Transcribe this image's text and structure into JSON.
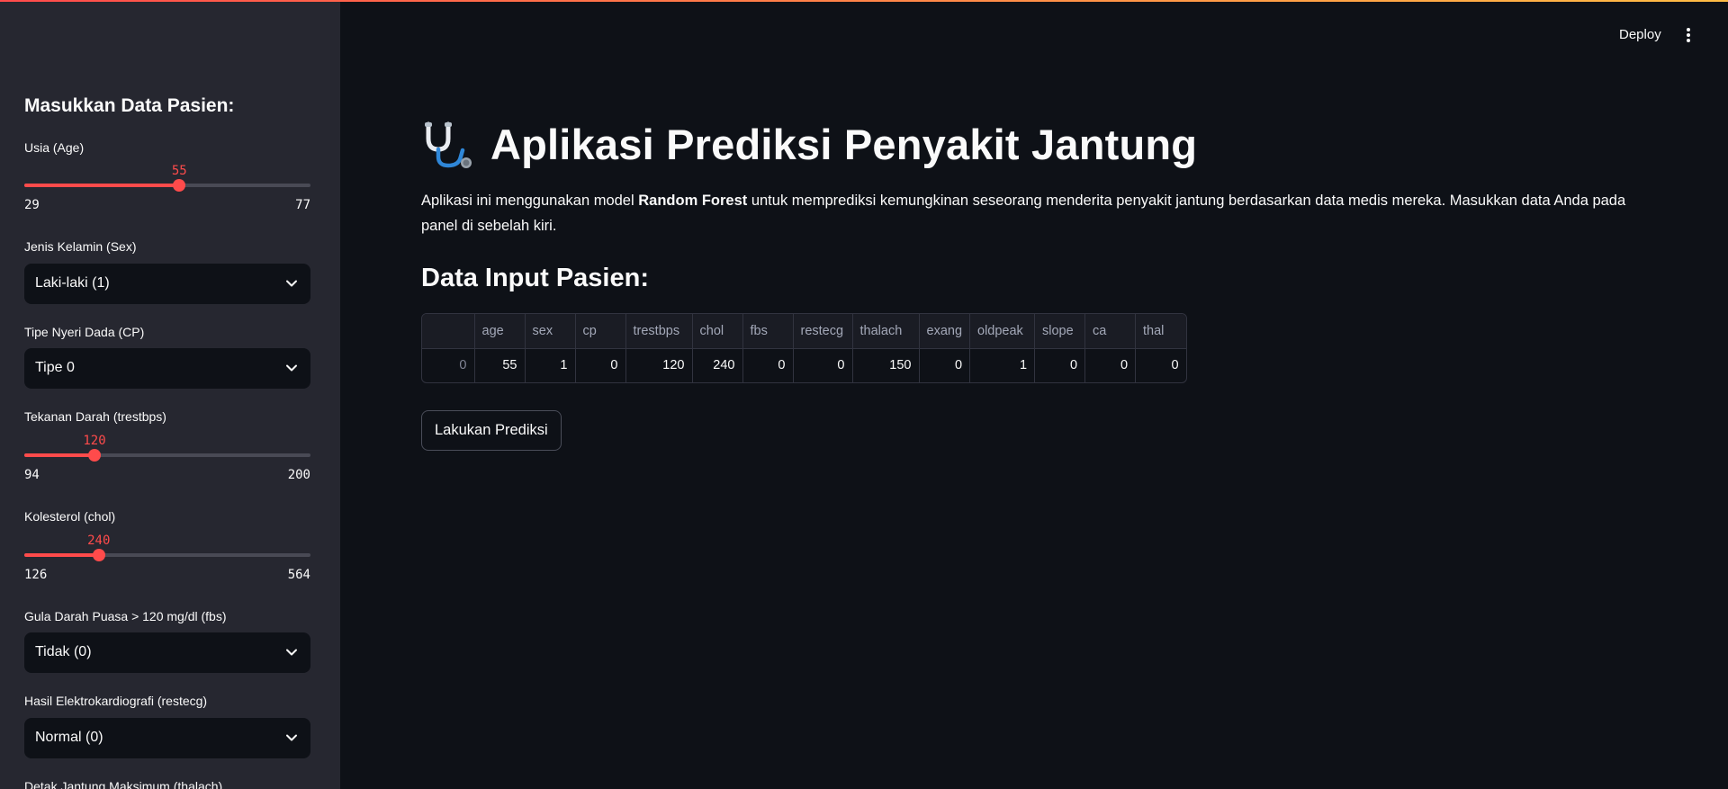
{
  "sidebar": {
    "heading": "Masukkan Data Pasien:",
    "age": {
      "label": "Usia (Age)",
      "value": "55",
      "min": "29",
      "max": "77",
      "fraction": 0.5417
    },
    "sex": {
      "label": "Jenis Kelamin (Sex)",
      "value": "Laki-laki (1)"
    },
    "cp": {
      "label": "Tipe Nyeri Dada (CP)",
      "value": "Tipe 0"
    },
    "trestbps": {
      "label": "Tekanan Darah (trestbps)",
      "value": "120",
      "min": "94",
      "max": "200",
      "fraction": 0.2453
    },
    "chol": {
      "label": "Kolesterol (chol)",
      "value": "240",
      "min": "126",
      "max": "564",
      "fraction": 0.2603
    },
    "fbs": {
      "label": "Gula Darah Puasa > 120 mg/dl (fbs)",
      "value": "Tidak (0)"
    },
    "restecg": {
      "label": "Hasil Elektrokardiografi (restecg)",
      "value": "Normal (0)"
    },
    "thalach": {
      "label": "Detak Jantung Maksimum (thalach)"
    }
  },
  "header": {
    "deploy_label": "Deploy",
    "menu_icon": "kebab-menu-icon"
  },
  "main": {
    "title_icon": "stethoscope-icon",
    "title": "Aplikasi Prediksi Penyakit Jantung",
    "description_pre": "Aplikasi ini menggunakan model ",
    "description_bold": "Random Forest",
    "description_post": " untuk memprediksi kemungkinan seseorang menderita penyakit jantung berdasarkan data medis mereka. Masukkan data Anda pada panel di sebelah kiri.",
    "section_title": "Data Input Pasien:",
    "table": {
      "columns": [
        "",
        "age",
        "sex",
        "cp",
        "trestbps",
        "chol",
        "fbs",
        "restecg",
        "thalach",
        "exang",
        "oldpeak",
        "slope",
        "ca",
        "thal"
      ],
      "rows": [
        [
          "0",
          "55",
          "1",
          "0",
          "120",
          "240",
          "0",
          "0",
          "150",
          "0",
          "1",
          "0",
          "0",
          "0"
        ]
      ]
    },
    "predict_button": "Lakukan Prediksi"
  },
  "colors": {
    "accent": "#ff4b4b",
    "background": "#0e1117",
    "sidebar": "#262730"
  }
}
